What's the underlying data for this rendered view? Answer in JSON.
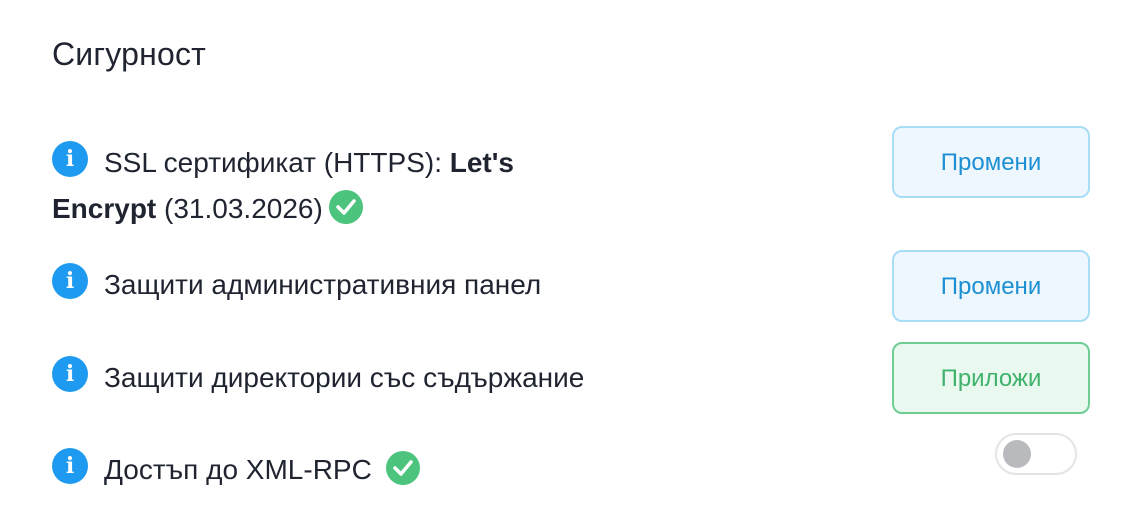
{
  "section": {
    "title": "Сигурност"
  },
  "rows": [
    {
      "icon": "info-icon",
      "label": "SSL сертификат (HTTPS):",
      "value": "Let's Encrypt",
      "date": "(31.03.2026)",
      "status_icon": "check-icon",
      "button_label": "Промени"
    },
    {
      "icon": "info-icon",
      "label": "Защити административния панел",
      "button_label": "Промени"
    },
    {
      "icon": "info-icon",
      "label": "Защити директории със съдържание",
      "button_label": "Приложи"
    },
    {
      "icon": "info-icon",
      "label": "Достъп до XML-RPC",
      "status_icon": "check-icon",
      "toggle_on": false
    }
  ],
  "colors": {
    "info": "#1e9bf0",
    "success": "#4cc47d",
    "button_blue_text": "#1d8fd3",
    "button_green_text": "#3fb26b"
  }
}
